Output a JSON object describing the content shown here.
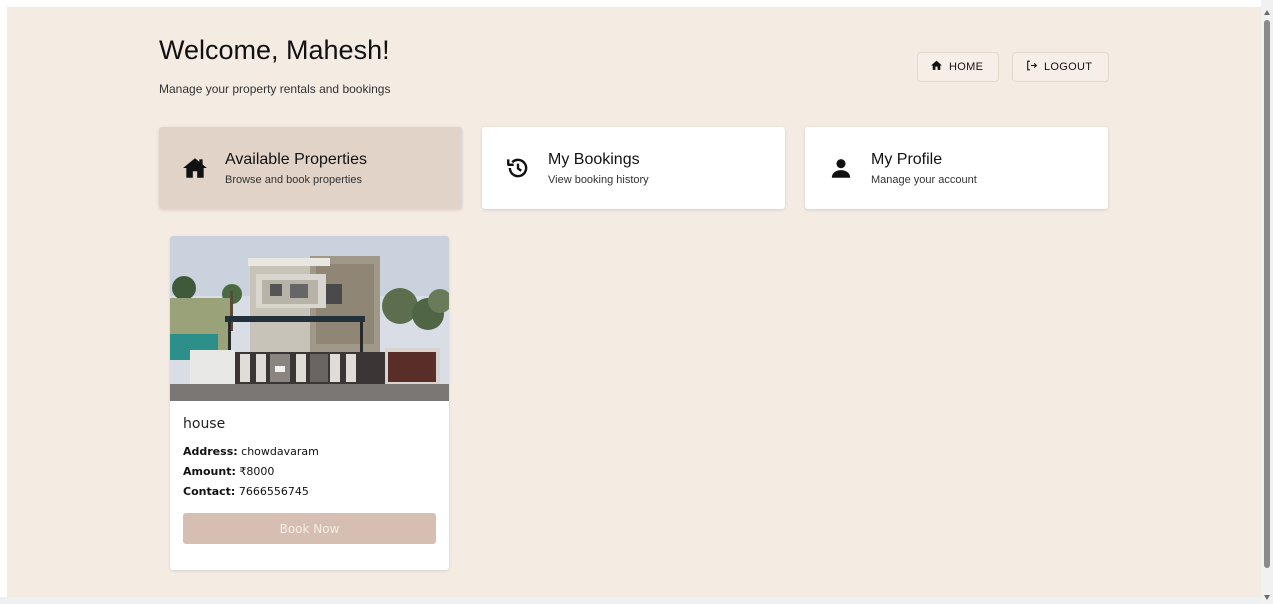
{
  "header": {
    "title": "Welcome, Mahesh!",
    "subtitle": "Manage your property rentals and bookings"
  },
  "nav": {
    "home_label": "HOME",
    "logout_label": "LOGOUT"
  },
  "tiles": [
    {
      "title": "Available Properties",
      "desc": "Browse and book properties",
      "icon": "house-icon",
      "active": true
    },
    {
      "title": "My Bookings",
      "desc": "View booking history",
      "icon": "history-icon",
      "active": false
    },
    {
      "title": "My Profile",
      "desc": "Manage your account",
      "icon": "person-icon",
      "active": false
    }
  ],
  "property": {
    "name": "house",
    "address_label": "Address:",
    "address": "chowdavaram",
    "amount_label": "Amount:",
    "amount": "₹8000",
    "contact_label": "Contact:",
    "contact": "7666556745",
    "book_label": "Book Now"
  },
  "colors": {
    "background": "#f4ebe3",
    "active_tile": "#e2d3c8",
    "book_button": "#d6bfb2"
  }
}
